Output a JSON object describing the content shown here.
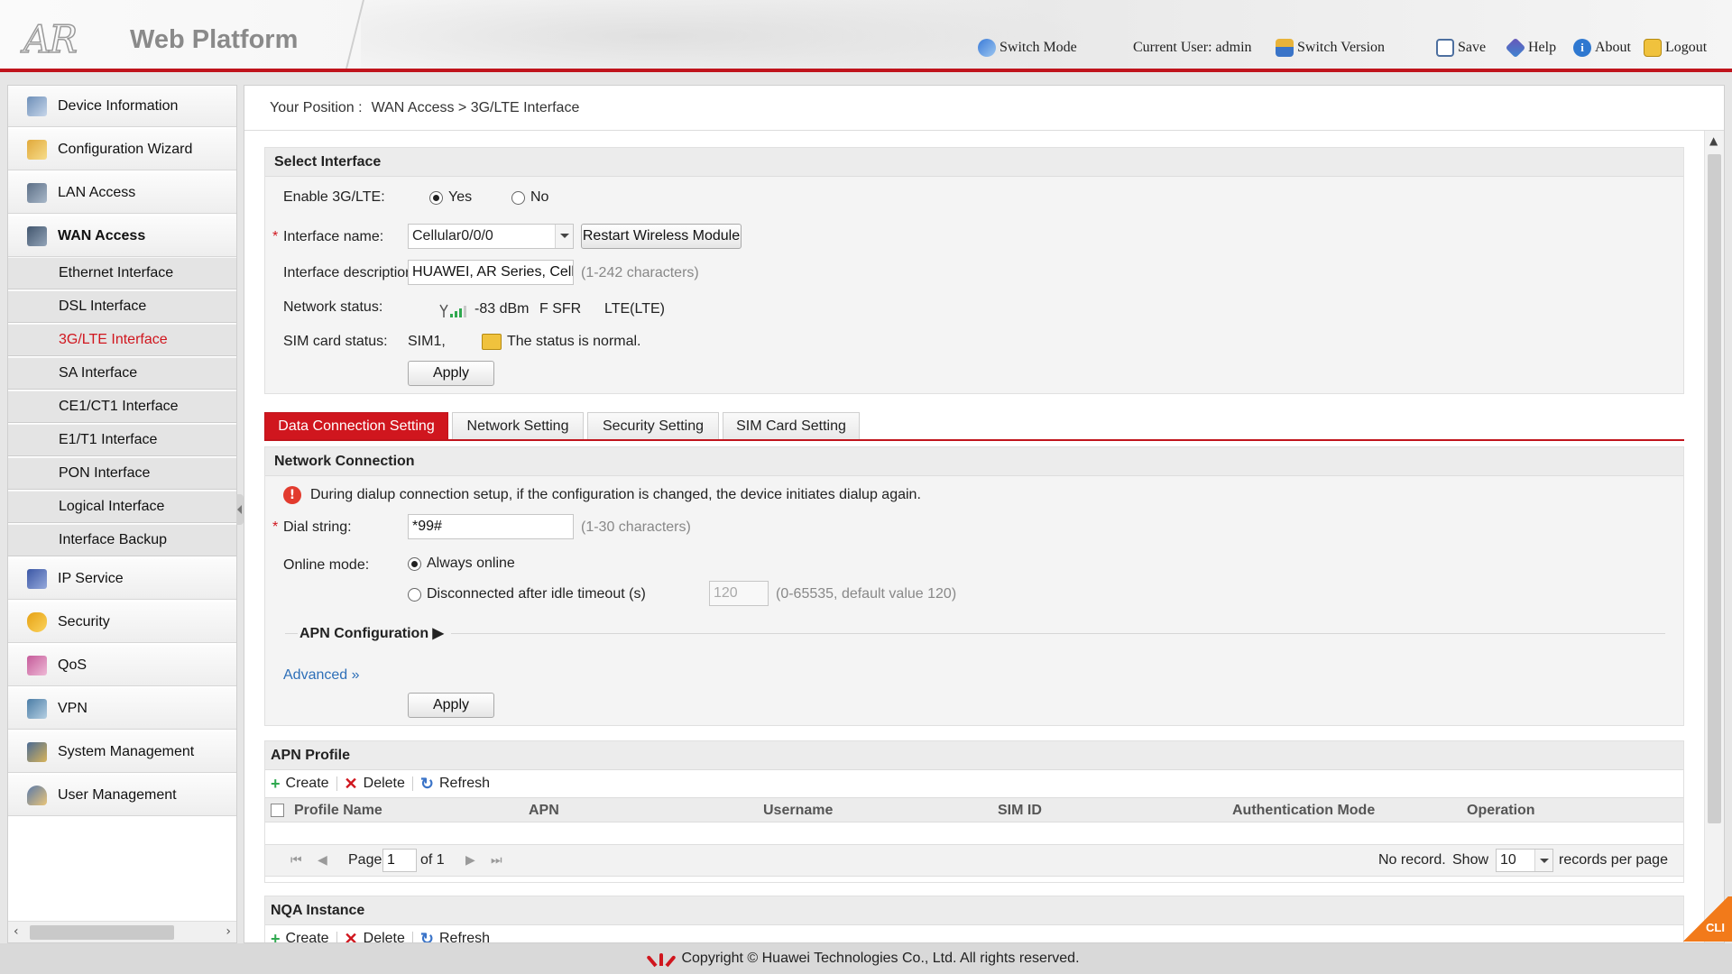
{
  "header": {
    "logo_mark": "AR",
    "logo_text": "Web Platform",
    "switch_mode": "Switch Mode",
    "current_user": "Current User: admin",
    "switch_version": "Switch Version",
    "save": "Save",
    "help": "Help",
    "about": "About",
    "logout": "Logout",
    "accent_color": "#c0141c"
  },
  "sidebar": {
    "items": [
      {
        "label": "Device Information",
        "icon": "device-info-icon"
      },
      {
        "label": "Configuration Wizard",
        "icon": "wizard-icon"
      },
      {
        "label": "LAN Access",
        "icon": "lan-icon"
      },
      {
        "label": "WAN Access",
        "icon": "wan-icon"
      },
      {
        "label": "IP Service",
        "icon": "ip-service-icon"
      },
      {
        "label": "Security",
        "icon": "shield-icon"
      },
      {
        "label": "QoS",
        "icon": "qos-icon"
      },
      {
        "label": "VPN",
        "icon": "vpn-icon"
      },
      {
        "label": "System Management",
        "icon": "system-icon"
      },
      {
        "label": "User Management",
        "icon": "user-icon"
      }
    ],
    "wan_subitems": [
      "Ethernet Interface",
      "DSL Interface",
      "3G/LTE Interface",
      "SA Interface",
      "CE1/CT1 Interface",
      "E1/T1 Interface",
      "PON Interface",
      "Logical Interface",
      "Interface Backup"
    ],
    "current_subitem": "3G/LTE Interface"
  },
  "breadcrumb": {
    "prefix": "Your Position :",
    "path": "WAN Access > 3G/LTE Interface"
  },
  "select_interface": {
    "title": "Select Interface",
    "enable_label": "Enable 3G/LTE:",
    "yes": "Yes",
    "no": "No",
    "enabled": true,
    "interface_name_label": "Interface name:",
    "interface_name_value": "Cellular0/0/0",
    "restart_button": "Restart Wireless Module",
    "description_label": "Interface description:",
    "description_value": "HUAWEI, AR Series, Cellul",
    "description_hint": "(1-242 characters)",
    "network_status_label": "Network status:",
    "signal": "-83 dBm",
    "operator": "F SFR",
    "mode": "LTE(LTE)",
    "sim_status_label": "SIM card status:",
    "sim_id": "SIM1,",
    "sim_status": "The status is normal.",
    "apply": "Apply"
  },
  "tabs": [
    {
      "label": "Data Connection Setting",
      "active": true
    },
    {
      "label": "Network Setting",
      "active": false
    },
    {
      "label": "Security Setting",
      "active": false
    },
    {
      "label": "SIM Card Setting",
      "active": false
    }
  ],
  "network_connection": {
    "title": "Network Connection",
    "warning": "During dialup connection setup, if the configuration is changed, the device initiates dialup again.",
    "dial_label": "Dial string:",
    "dial_value": "*99#",
    "dial_hint": "(1-30 characters)",
    "online_mode_label": "Online mode:",
    "always_online": "Always online",
    "disconnect_option": "Disconnected after idle timeout (s)",
    "timeout_value": "120",
    "timeout_hint": "(0-65535, default value 120)",
    "apn_config": "APN Configuration ▶",
    "advanced": "Advanced »",
    "apply": "Apply"
  },
  "apn_profile": {
    "title": "APN Profile",
    "create": "Create",
    "delete": "Delete",
    "refresh": "Refresh",
    "columns": [
      "Profile Name",
      "APN",
      "Username",
      "SIM ID",
      "Authentication Mode",
      "Operation"
    ],
    "page_label": "Page",
    "page_value": "1",
    "of_label": "of 1",
    "no_record": "No record.",
    "show_label": "Show",
    "per_page": "10",
    "records_label": "records per page"
  },
  "nqa_instance": {
    "title": "NQA Instance",
    "create": "Create",
    "delete": "Delete",
    "refresh": "Refresh"
  },
  "footer": {
    "copyright": "Copyright © Huawei Technologies Co., Ltd. All rights reserved.",
    "cli": "CLI"
  }
}
